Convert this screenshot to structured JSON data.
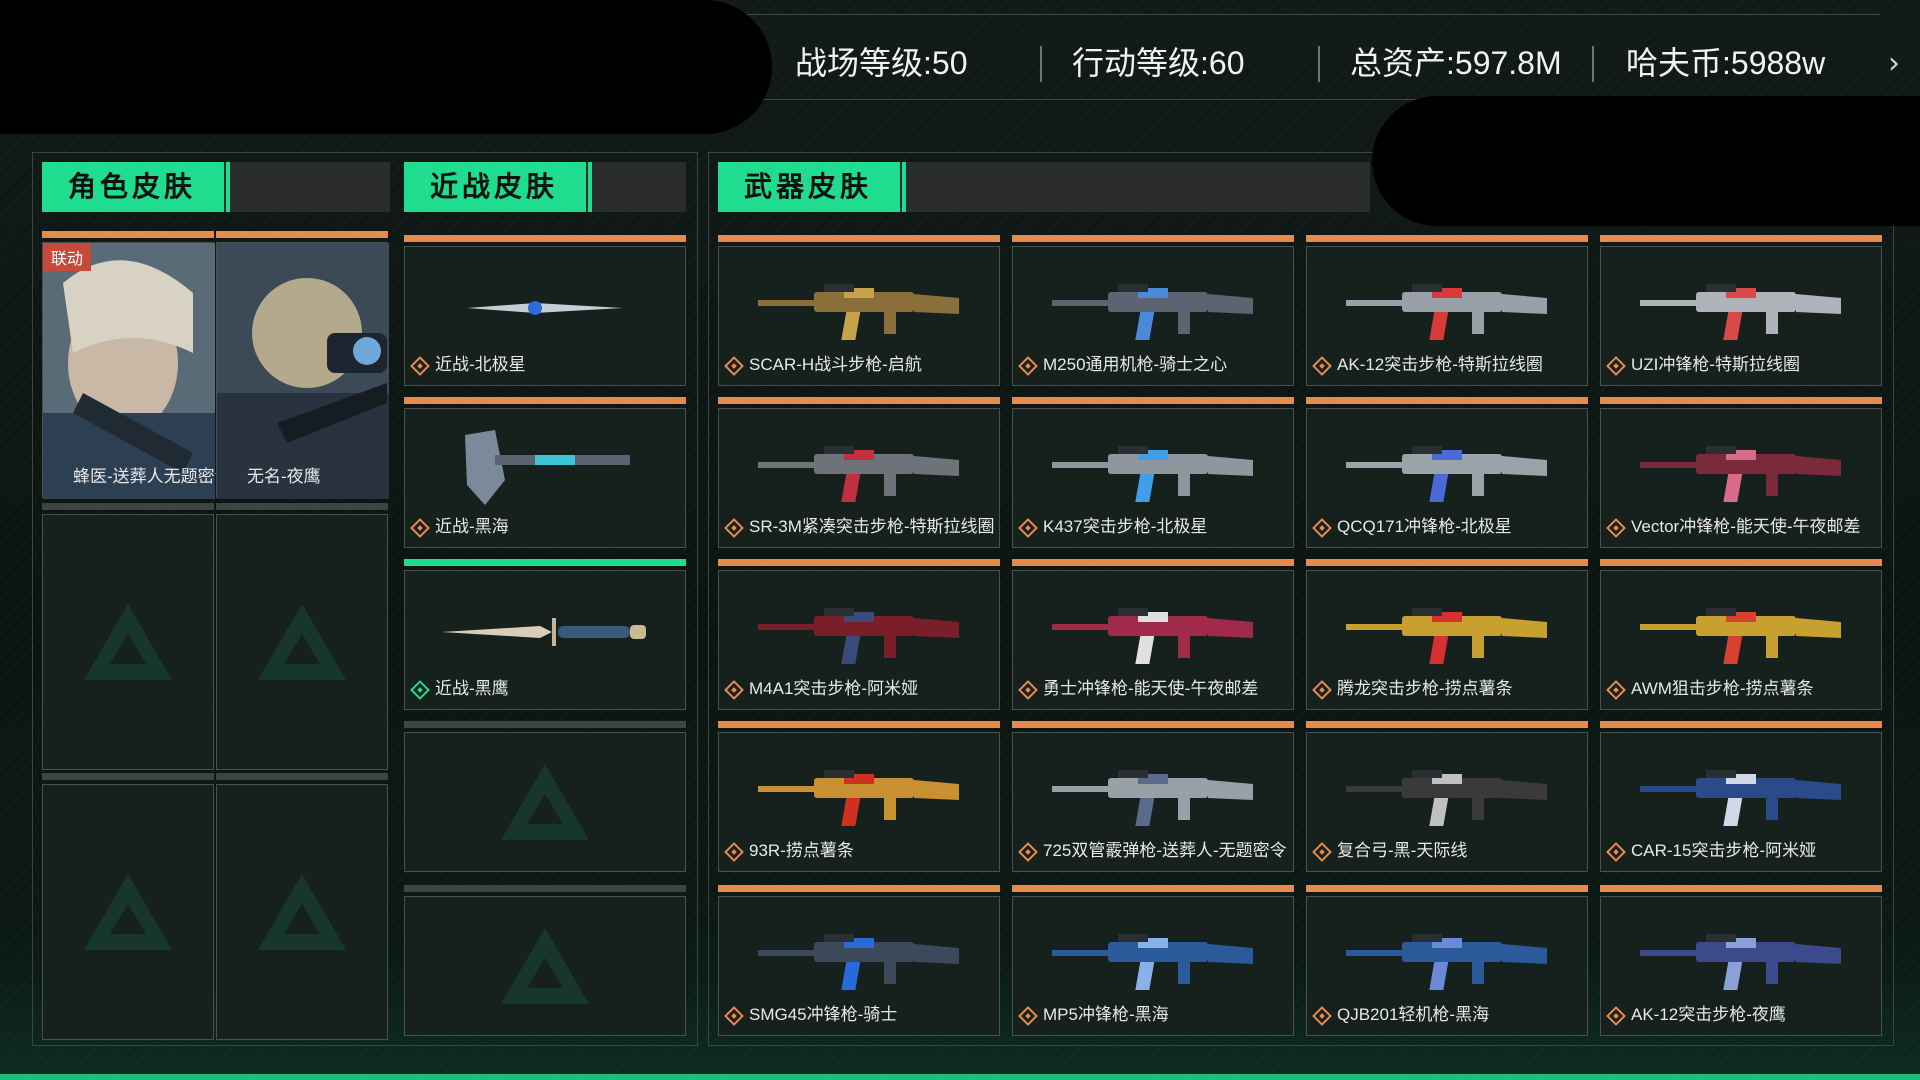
{
  "stats": {
    "battlefield_level": "战场等级:50",
    "operation_level": "行动等级:60",
    "total_assets": "总资产:597.8M",
    "havoc_coin": "哈夫币:5988w"
  },
  "sections": {
    "character": "角色皮肤",
    "melee": "近战皮肤",
    "weapon": "武器皮肤"
  },
  "character_skins": [
    {
      "label": "蜂医-送葬人无题密令",
      "tag": "联动"
    },
    {
      "label": "无名-夜鹰"
    }
  ],
  "melee_skins": [
    {
      "label": "近战-北极星",
      "rarity": "orange"
    },
    {
      "label": "近战-黑海",
      "rarity": "orange"
    },
    {
      "label": "近战-黑鹰",
      "rarity": "green"
    }
  ],
  "weapon_skins": [
    {
      "label": "SCAR-H战斗步枪-启航"
    },
    {
      "label": "M250通用机枪-骑士之心"
    },
    {
      "label": "AK-12突击步枪-特斯拉线圈"
    },
    {
      "label": "UZI冲锋枪-特斯拉线圈"
    },
    {
      "label": "SR-3M紧凑突击步枪-特斯拉线圈"
    },
    {
      "label": "K437突击步枪-北极星"
    },
    {
      "label": "QCQ171冲锋枪-北极星"
    },
    {
      "label": "Vector冲锋枪-能天使-午夜邮差"
    },
    {
      "label": "M4A1突击步枪-阿米娅"
    },
    {
      "label": "勇士冲锋枪-能天使-午夜邮差"
    },
    {
      "label": "腾龙突击步枪-捞点薯条"
    },
    {
      "label": "AWM狙击步枪-捞点薯条"
    },
    {
      "label": "93R-捞点薯条"
    },
    {
      "label": "725双管霰弹枪-送葬人-无题密令"
    },
    {
      "label": "复合弓-黑-天际线"
    },
    {
      "label": "CAR-15突击步枪-阿米娅"
    },
    {
      "label": "SMG45冲锋枪-骑士"
    },
    {
      "label": "MP5冲锋枪-黑海"
    },
    {
      "label": "QJB201轻机枪-黑海"
    },
    {
      "label": "AK-12突击步枪-夜鹰"
    }
  ],
  "colors": {
    "accent_green": "#1fdc8e",
    "rarity_orange": "#e88a4c"
  }
}
